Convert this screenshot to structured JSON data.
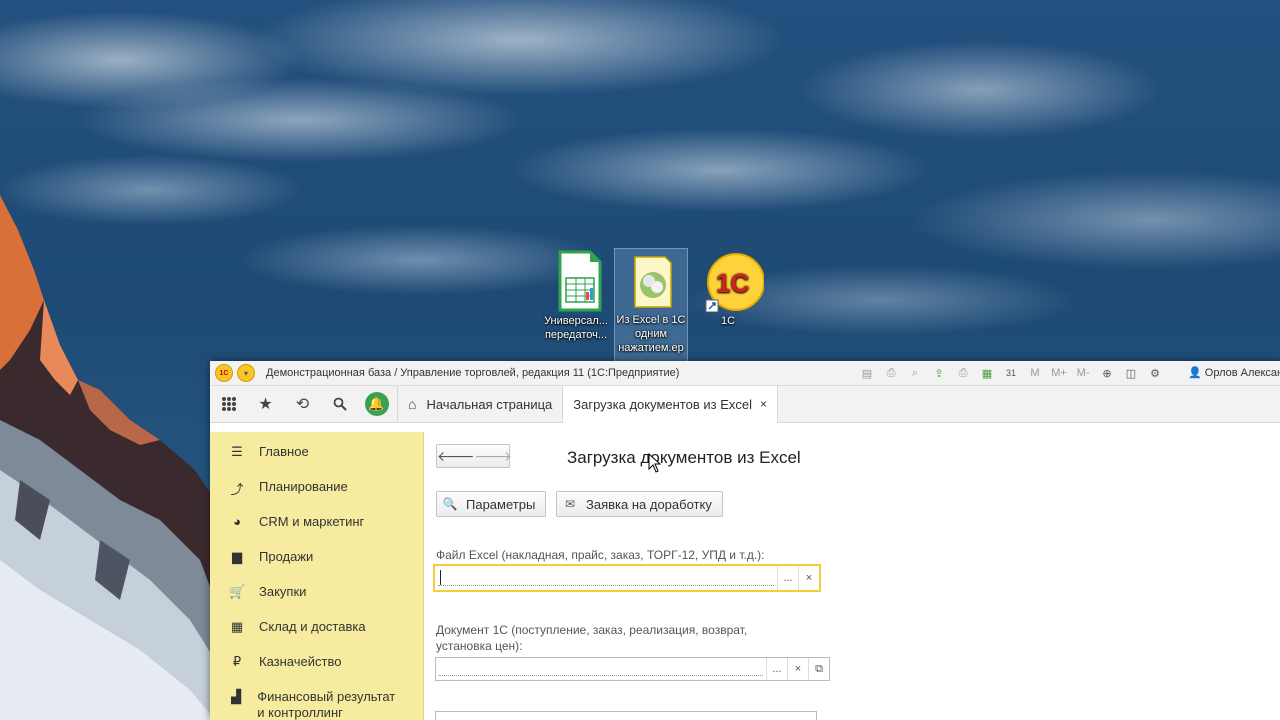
{
  "desktop": {
    "icons": [
      {
        "label": "Универсал... передаточ...",
        "type": "spreadsheet"
      },
      {
        "label": "Из Excel в 1С одним нажатием.ep",
        "type": "epf"
      },
      {
        "label": "1С",
        "type": "1c-shortcut"
      }
    ]
  },
  "window": {
    "title": "Демонстрационная база / Управление торговлей, редакция 11  (1С:Предприятие)",
    "user": "Орлов Алексан",
    "toolbar_icons": [
      "doc-icon",
      "print-icon",
      "preview-icon",
      "upload-icon",
      "printer-icon",
      "calculator-icon",
      "calendar-icon",
      "m-icon",
      "m-plus-icon",
      "m-minus-icon",
      "zoom-icon",
      "panel-icon",
      "settings-icon"
    ],
    "toolbar_text": {
      "m": "M",
      "mplus": "M+",
      "mminus": "M-",
      "calendar_day": "31"
    },
    "logo_text": "1С"
  },
  "tabs": {
    "home": "Начальная страница",
    "active": "Загрузка документов из Excel",
    "close": "×"
  },
  "sidebar": {
    "items": [
      {
        "label": "Главное",
        "icon": "menu-icon"
      },
      {
        "label": "Планирование",
        "icon": "planning-icon"
      },
      {
        "label": "CRM и маркетинг",
        "icon": "pie-icon"
      },
      {
        "label": "Продажи",
        "icon": "bag-icon"
      },
      {
        "label": "Закупки",
        "icon": "cart-icon"
      },
      {
        "label": "Склад и доставка",
        "icon": "grid-icon"
      },
      {
        "label": "Казначейство",
        "icon": "ruble-icon"
      },
      {
        "label": "Финансовый результат и контроллинг",
        "icon": "chart-icon"
      }
    ]
  },
  "form": {
    "title": "Загрузка документов из Excel",
    "params_button": "Параметры",
    "request_button": "Заявка на доработку",
    "file_label": "Файл Excel (накладная, прайс, заказ, ТОРГ-12, УПД и т.д.):",
    "file_value": "",
    "doc_label": "Документ 1С (поступление, заказ, реализация, возврат, установка цен):",
    "doc_value": "",
    "select_btn": "...",
    "clear_btn": "×",
    "open_btn": "⧉"
  }
}
